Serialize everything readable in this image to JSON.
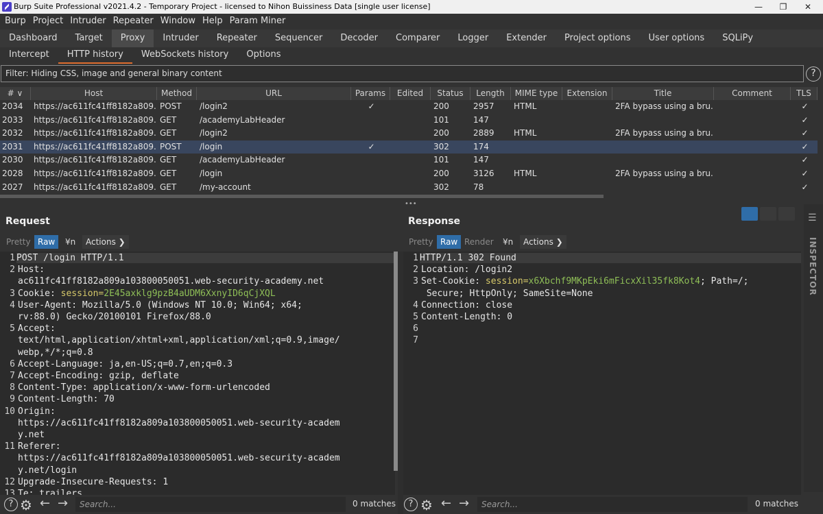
{
  "window": {
    "title": "Burp Suite Professional v2021.4.2 - Temporary Project - licensed to Nihon Buissiness Data [single user license]",
    "min": "—",
    "restore": "❐",
    "close": "✕"
  },
  "menu": [
    "Burp",
    "Project",
    "Intruder",
    "Repeater",
    "Window",
    "Help",
    "Param Miner"
  ],
  "main_tabs": [
    "Dashboard",
    "Target",
    "Proxy",
    "Intruder",
    "Repeater",
    "Sequencer",
    "Decoder",
    "Comparer",
    "Logger",
    "Extender",
    "Project options",
    "User options",
    "SQLiPy"
  ],
  "active_main_tab": "Proxy",
  "proxy_tabs": [
    "Intercept",
    "HTTP history",
    "WebSockets history",
    "Options"
  ],
  "active_proxy_tab": "HTTP history",
  "filter": "Filter: Hiding CSS, image and general binary content",
  "help_glyph": "?",
  "table": {
    "columns": [
      "# ∨",
      "Host",
      "Method",
      "URL",
      "Params",
      "Edited",
      "Status",
      "Length",
      "MIME type",
      "Extension",
      "Title",
      "Comment",
      "TLS"
    ],
    "rows": [
      {
        "num": "2034",
        "host": "https://ac611fc41ff8182a809...",
        "method": "POST",
        "url": "/login2",
        "params": "✓",
        "status": "200",
        "length": "2957",
        "mime": "HTML",
        "title": "2FA bypass using a bru...",
        "tls": "✓"
      },
      {
        "num": "2033",
        "host": "https://ac611fc41ff8182a809...",
        "method": "GET",
        "url": "/academyLabHeader",
        "params": "",
        "status": "101",
        "length": "147",
        "mime": "",
        "title": "",
        "tls": "✓"
      },
      {
        "num": "2032",
        "host": "https://ac611fc41ff8182a809...",
        "method": "GET",
        "url": "/login2",
        "params": "",
        "status": "200",
        "length": "2889",
        "mime": "HTML",
        "title": "2FA bypass using a bru...",
        "tls": "✓"
      },
      {
        "num": "2031",
        "host": "https://ac611fc41ff8182a809...",
        "method": "POST",
        "url": "/login",
        "params": "✓",
        "status": "302",
        "length": "174",
        "mime": "",
        "title": "",
        "tls": "✓",
        "selected": true
      },
      {
        "num": "2030",
        "host": "https://ac611fc41ff8182a809...",
        "method": "GET",
        "url": "/academyLabHeader",
        "params": "",
        "status": "101",
        "length": "147",
        "mime": "",
        "title": "",
        "tls": "✓"
      },
      {
        "num": "2028",
        "host": "https://ac611fc41ff8182a809...",
        "method": "GET",
        "url": "/login",
        "params": "",
        "status": "200",
        "length": "3126",
        "mime": "HTML",
        "title": "2FA bypass using a bru...",
        "tls": "✓"
      },
      {
        "num": "2027",
        "host": "https://ac611fc41ff8182a809...",
        "method": "GET",
        "url": "/my-account",
        "params": "",
        "status": "302",
        "length": "78",
        "mime": "",
        "title": "",
        "tls": "✓"
      }
    ]
  },
  "request": {
    "heading": "Request",
    "buttons": {
      "pretty": "Pretty",
      "raw": "Raw",
      "newline": "¥n",
      "actions": "Actions ❯"
    },
    "lines": [
      {
        "n": "1",
        "segs": [
          {
            "t": "POST /login HTTP/1.1",
            "c": ""
          }
        ],
        "first": true
      },
      {
        "n": "2",
        "segs": [
          {
            "t": "Host:",
            "c": ""
          }
        ]
      },
      {
        "n": "",
        "segs": [
          {
            "t": "ac611fc41ff8182a809a103800050051.web-security-academy.net",
            "c": ""
          }
        ]
      },
      {
        "n": "3",
        "segs": [
          {
            "t": "Cookie: ",
            "c": ""
          },
          {
            "t": "session=",
            "c": "v"
          },
          {
            "t": "2E45axklg9pzB4aUDM6XxnyID6qCjXQL",
            "c": "vg"
          }
        ]
      },
      {
        "n": "4",
        "segs": [
          {
            "t": "User-Agent: Mozilla/5.0 (Windows NT 10.0; Win64; x64;",
            "c": ""
          }
        ]
      },
      {
        "n": "",
        "segs": [
          {
            "t": "rv:88.0) Gecko/20100101 Firefox/88.0",
            "c": ""
          }
        ]
      },
      {
        "n": "5",
        "segs": [
          {
            "t": "Accept:",
            "c": ""
          }
        ]
      },
      {
        "n": "",
        "segs": [
          {
            "t": "text/html,application/xhtml+xml,application/xml;q=0.9,image/",
            "c": ""
          }
        ]
      },
      {
        "n": "",
        "segs": [
          {
            "t": "webp,*/*;q=0.8",
            "c": ""
          }
        ]
      },
      {
        "n": "6",
        "segs": [
          {
            "t": "Accept-Language: ja,en-US;q=0.7,en;q=0.3",
            "c": ""
          }
        ]
      },
      {
        "n": "7",
        "segs": [
          {
            "t": "Accept-Encoding: gzip, deflate",
            "c": ""
          }
        ]
      },
      {
        "n": "8",
        "segs": [
          {
            "t": "Content-Type: application/x-www-form-urlencoded",
            "c": ""
          }
        ]
      },
      {
        "n": "9",
        "segs": [
          {
            "t": "Content-Length: 70",
            "c": ""
          }
        ]
      },
      {
        "n": "10",
        "segs": [
          {
            "t": "Origin:",
            "c": ""
          }
        ]
      },
      {
        "n": "",
        "segs": [
          {
            "t": "https://ac611fc41ff8182a809a103800050051.web-security-academ",
            "c": ""
          }
        ]
      },
      {
        "n": "",
        "segs": [
          {
            "t": "y.net",
            "c": ""
          }
        ]
      },
      {
        "n": "11",
        "segs": [
          {
            "t": "Referer:",
            "c": ""
          }
        ]
      },
      {
        "n": "",
        "segs": [
          {
            "t": "https://ac611fc41ff8182a809a103800050051.web-security-academ",
            "c": ""
          }
        ]
      },
      {
        "n": "",
        "segs": [
          {
            "t": "y.net/login",
            "c": ""
          }
        ]
      },
      {
        "n": "12",
        "segs": [
          {
            "t": "Upgrade-Insecure-Requests: 1",
            "c": ""
          }
        ]
      },
      {
        "n": "13",
        "segs": [
          {
            "t": "Te: trailers",
            "c": ""
          }
        ]
      }
    ],
    "search_placeholder": "Search...",
    "matches": "0 matches"
  },
  "response": {
    "heading": "Response",
    "buttons": {
      "pretty": "Pretty",
      "raw": "Raw",
      "render": "Render",
      "newline": "¥n",
      "actions": "Actions ❯"
    },
    "lines": [
      {
        "n": "1",
        "segs": [
          {
            "t": "HTTP/1.1 302 Found",
            "c": ""
          }
        ],
        "first": true
      },
      {
        "n": "2",
        "segs": [
          {
            "t": "Location: /login2",
            "c": ""
          }
        ]
      },
      {
        "n": "3",
        "segs": [
          {
            "t": "Set-Cookie: ",
            "c": ""
          },
          {
            "t": "session=",
            "c": "v"
          },
          {
            "t": "x6Xbchf9MKpEki6mFicxXil35fk8Kot4",
            "c": "vg"
          },
          {
            "t": "; Path=/;",
            "c": ""
          }
        ]
      },
      {
        "n": "",
        "segs": [
          {
            "t": " Secure; HttpOnly; SameSite=None",
            "c": ""
          }
        ]
      },
      {
        "n": "4",
        "segs": [
          {
            "t": "Connection: close",
            "c": ""
          }
        ]
      },
      {
        "n": "5",
        "segs": [
          {
            "t": "Content-Length: 0",
            "c": ""
          }
        ]
      },
      {
        "n": "6",
        "segs": []
      },
      {
        "n": "7",
        "segs": []
      }
    ],
    "search_placeholder": "Search...",
    "matches": "0 matches"
  },
  "inspector": {
    "label": "INSPECTOR",
    "menu_glyph": "☰"
  },
  "bottom_glyphs": {
    "help": "?",
    "settings": "⚙",
    "back": "←",
    "forward": "→"
  }
}
